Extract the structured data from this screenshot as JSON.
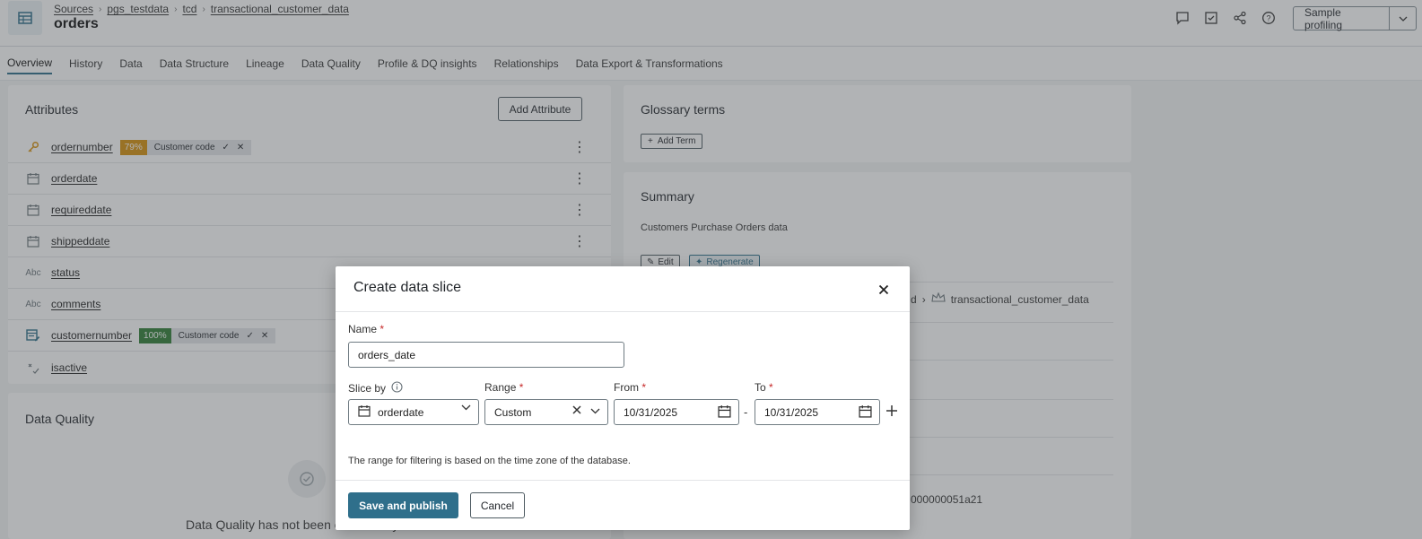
{
  "header": {
    "breadcrumb": [
      "Sources",
      "pgs_testdata",
      "tcd",
      "transactional_customer_data"
    ],
    "title": "orders",
    "sample_button": "Sample profiling"
  },
  "tabs": [
    "Overview",
    "History",
    "Data",
    "Data Structure",
    "Lineage",
    "Data Quality",
    "Profile & DQ insights",
    "Relationships",
    "Data Export & Transformations"
  ],
  "attributes": {
    "title": "Attributes",
    "add_button": "Add Attribute",
    "rows": [
      {
        "name": "ordernumber",
        "icon": "key-icon",
        "pct": "79%",
        "term": "Customer code"
      },
      {
        "name": "orderdate",
        "icon": "calendar-icon"
      },
      {
        "name": "requireddate",
        "icon": "calendar-icon"
      },
      {
        "name": "shippeddate",
        "icon": "calendar-icon"
      },
      {
        "name": "status",
        "icon": "text-type-icon",
        "type_label": "Abc"
      },
      {
        "name": "comments",
        "icon": "text-type-icon",
        "type_label": "Abc"
      },
      {
        "name": "customernumber",
        "icon": "table-edit-icon",
        "pct": "100%",
        "term": "Customer code"
      },
      {
        "name": "isactive",
        "icon": "boolean-type-icon"
      }
    ]
  },
  "data_quality": {
    "title": "Data Quality",
    "message": "Data Quality has not been evaluated yet"
  },
  "glossary": {
    "title": "Glossary terms",
    "add_term": "Add Term"
  },
  "summary": {
    "title": "Summary",
    "description": "Customers Purchase Orders data",
    "edit": "Edit",
    "regenerate": "Regenerate",
    "lineage_fragment": "d",
    "lineage_item": "transactional_customer_data",
    "id_fragment": "000000051a21"
  },
  "colors": {
    "accent": "#2f6f8b",
    "pct_79": "#d68f0a",
    "pct_100": "#2e7d32",
    "required": "#c62828"
  },
  "modal": {
    "title": "Create data slice",
    "name_label": "Name",
    "name_value": "orders_date",
    "slice_by_label": "Slice by",
    "slice_by_value": "orderdate",
    "range_label": "Range",
    "range_value": "Custom",
    "from_label": "From",
    "from_value": "10/31/2025",
    "to_label": "To",
    "to_value": "10/31/2025",
    "dash": "-",
    "note": "The range for filtering is based on the time zone of the database.",
    "save_button": "Save and publish",
    "cancel_button": "Cancel"
  }
}
